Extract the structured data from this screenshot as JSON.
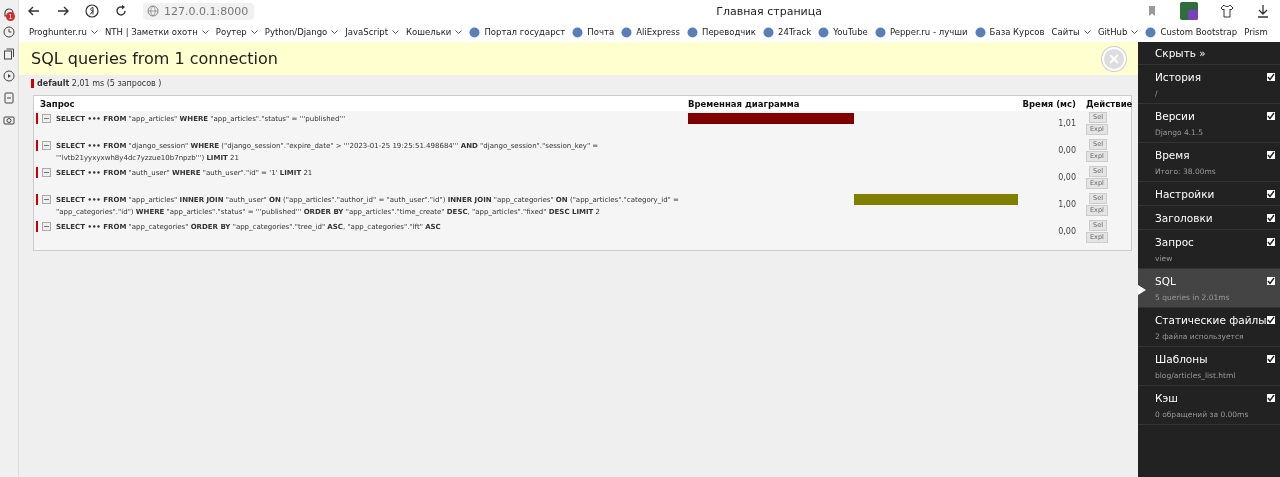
{
  "browser": {
    "notification_badge": "1",
    "url": "127.0.0.1:8000",
    "page_title": "Главная страница",
    "bookmarks": [
      {
        "label": "Proghunter.ru",
        "kind": "folder"
      },
      {
        "label": "NTH | Заметки охотн",
        "kind": "folder"
      },
      {
        "label": "Роутер",
        "kind": "folder"
      },
      {
        "label": "Python/Django",
        "kind": "folder"
      },
      {
        "label": "JavaScript",
        "kind": "folder"
      },
      {
        "label": "Кошельки",
        "kind": "folder"
      },
      {
        "label": "Портал государст",
        "kind": "link"
      },
      {
        "label": "Почта",
        "kind": "link"
      },
      {
        "label": "AliExpress",
        "kind": "link"
      },
      {
        "label": "Переводчик",
        "kind": "link"
      },
      {
        "label": "24Track",
        "kind": "link"
      },
      {
        "label": "YouTube",
        "kind": "link"
      },
      {
        "label": "Pepper.ru - лучши",
        "kind": "link"
      },
      {
        "label": "База Курсов",
        "kind": "link"
      },
      {
        "label": "Сайты",
        "kind": "folder"
      },
      {
        "label": "GitHub",
        "kind": "folder"
      },
      {
        "label": "Custom Bootstrap",
        "kind": "link"
      },
      {
        "label": "Prism",
        "kind": "plain"
      }
    ]
  },
  "panel": {
    "title": "SQL queries from 1 connection",
    "connection": {
      "name": "default",
      "summary": "2,01 ms (5 запросов )"
    },
    "columns": [
      "Запрос",
      "Временная диаграмма",
      "Время (мс)",
      "Действие"
    ],
    "queries": [
      {
        "sql": "**SELECT ••• FROM** \"app_articles\" **WHERE** \"app_articles\".\"status\" = '''published'''",
        "color": "#800000",
        "time": "1,01",
        "buttons": [
          "Sel",
          "Expl"
        ]
      },
      {
        "sql": "**SELECT ••• FROM** \"django_session\" **WHERE** (\"django_session\".\"expire_date\" > '''2023-01-25 19:25:51.498684''' **AND** \"django_session\".\"session_key\" = '''lvtb21yyxyxwh8y4dc7yzzue10b7npzb''') **LIMIT** 21",
        "time": "0,00",
        "buttons": [
          "Sel",
          "Expl"
        ]
      },
      {
        "sql": "**SELECT ••• FROM** \"auth_user\" **WHERE** \"auth_user\".\"id\" = '1' **LIMIT** 21",
        "time": "0,00",
        "buttons": [
          "Sel",
          "Expl"
        ]
      },
      {
        "sql": "**SELECT ••• FROM** \"app_articles\" **INNER JOIN** \"auth_user\" **ON** (\"app_articles\".\"author_id\" = \"auth_user\".\"id\") **INNER JOIN** \"app_categories\" **ON** (\"app_articles\".\"category_id\" = \"app_categories\".\"id\") **WHERE** \"app_articles\".\"status\" = '''published''' **ORDER BY** \"app_articles\".\"time_create\" **DESC**, \"app_articles\".\"fixed\" **DESC LIMIT** 2",
        "color": "#808000",
        "time": "1,00",
        "buttons": [
          "Sel",
          "Expl"
        ]
      },
      {
        "sql": "**SELECT ••• FROM** \"app_categories\" **ORDER BY** \"app_categories\".\"tree_id\" **ASC**, \"app_categories\".\"lft\" **ASC**",
        "time": "0,00",
        "buttons": [
          "Sel",
          "Expl"
        ]
      }
    ]
  },
  "toolbar": {
    "hide": "Скрыть »",
    "items": [
      {
        "title": "История",
        "subtitle": "/",
        "checked": true,
        "selected": false
      },
      {
        "title": "Версии",
        "subtitle": "Django 4.1.5",
        "checked": true,
        "selected": false
      },
      {
        "title": "Время",
        "subtitle": "Итого: 38.00ms",
        "checked": true,
        "selected": false
      },
      {
        "title": "Настройки",
        "checked": true,
        "selected": false
      },
      {
        "title": "Заголовки",
        "checked": true,
        "selected": false
      },
      {
        "title": "Запрос",
        "subtitle": "view",
        "checked": true,
        "selected": false
      },
      {
        "title": "SQL",
        "subtitle": "5 queries in 2.01ms",
        "checked": true,
        "selected": true
      },
      {
        "title": "Статические файлы",
        "subtitle": "2 файла используется",
        "checked": true,
        "selected": false
      },
      {
        "title": "Шаблоны",
        "subtitle": "blog/articles_list.html",
        "checked": true,
        "selected": false
      },
      {
        "title": "Кэш",
        "subtitle": "0 обращений за 0.00ms",
        "checked": true,
        "selected": false
      }
    ]
  }
}
